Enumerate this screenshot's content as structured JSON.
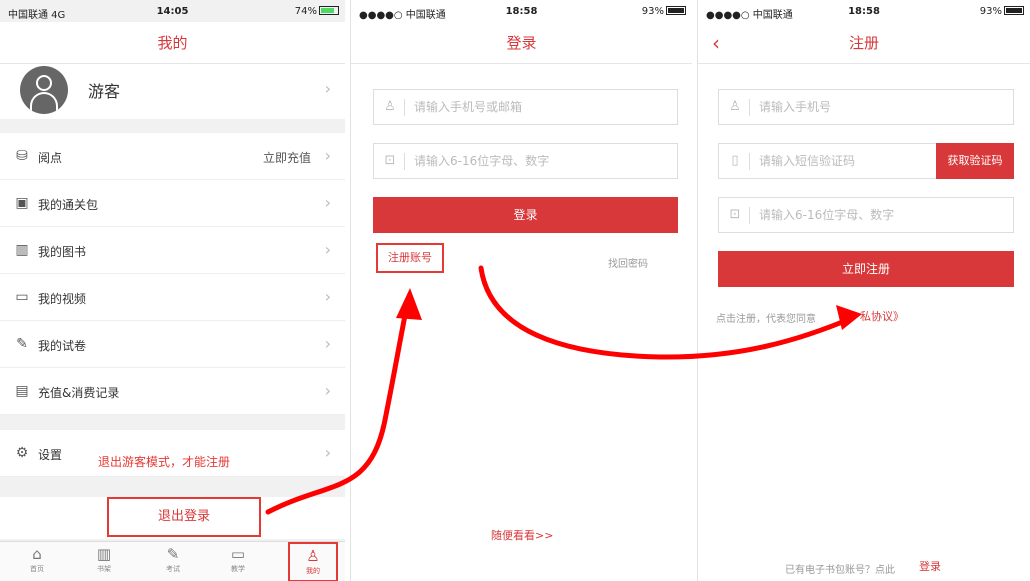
{
  "screen1": {
    "status": {
      "carrier": "中国联通 4G",
      "time": "14:05",
      "battery": "74%"
    },
    "title": "我的",
    "user": {
      "name": "游客"
    },
    "items": [
      {
        "label": "阅点",
        "extra": "立即充值",
        "icon": "coin-icon"
      },
      {
        "label": "我的通关包",
        "icon": "package-icon"
      },
      {
        "label": "我的图书",
        "icon": "books-icon"
      },
      {
        "label": "我的视频",
        "icon": "video-icon"
      },
      {
        "label": "我的试卷",
        "icon": "exam-paper-icon"
      },
      {
        "label": "充值&消费记录",
        "icon": "record-icon"
      },
      {
        "label": "设置",
        "icon": "gear-icon"
      }
    ],
    "note": "退出游客模式，才能注册",
    "logout": "退出登录",
    "tabs": [
      "首页",
      "书架",
      "考试",
      "教学",
      "我的"
    ]
  },
  "screen2": {
    "status": {
      "carrier": "●●●●○ 中国联通",
      "time": "18:58",
      "battery": "93%"
    },
    "title": "登录",
    "account_placeholder": "请输入手机号或邮箱",
    "password_placeholder": "请输入6-16位字母、数字",
    "login": "登录",
    "register": "注册账号",
    "forgot": "找回密码",
    "browse": "随便看看>>"
  },
  "screen3": {
    "status": {
      "carrier": "●●●●○ 中国联通",
      "time": "18:58",
      "battery": "93%"
    },
    "title": "注册",
    "phone_placeholder": "请输入手机号",
    "code_placeholder": "请输入短信验证码",
    "get_code": "获取验证码",
    "password_placeholder": "请输入6-16位字母、数字",
    "submit": "立即注册",
    "agree_prefix": "点击注册，代表您同意",
    "agree_link": "私协议》",
    "footer_text": "已有电子书包账号？点此",
    "footer_link": "登录"
  },
  "colors": {
    "accent": "#d9383a",
    "annotation": "#ff0000"
  }
}
